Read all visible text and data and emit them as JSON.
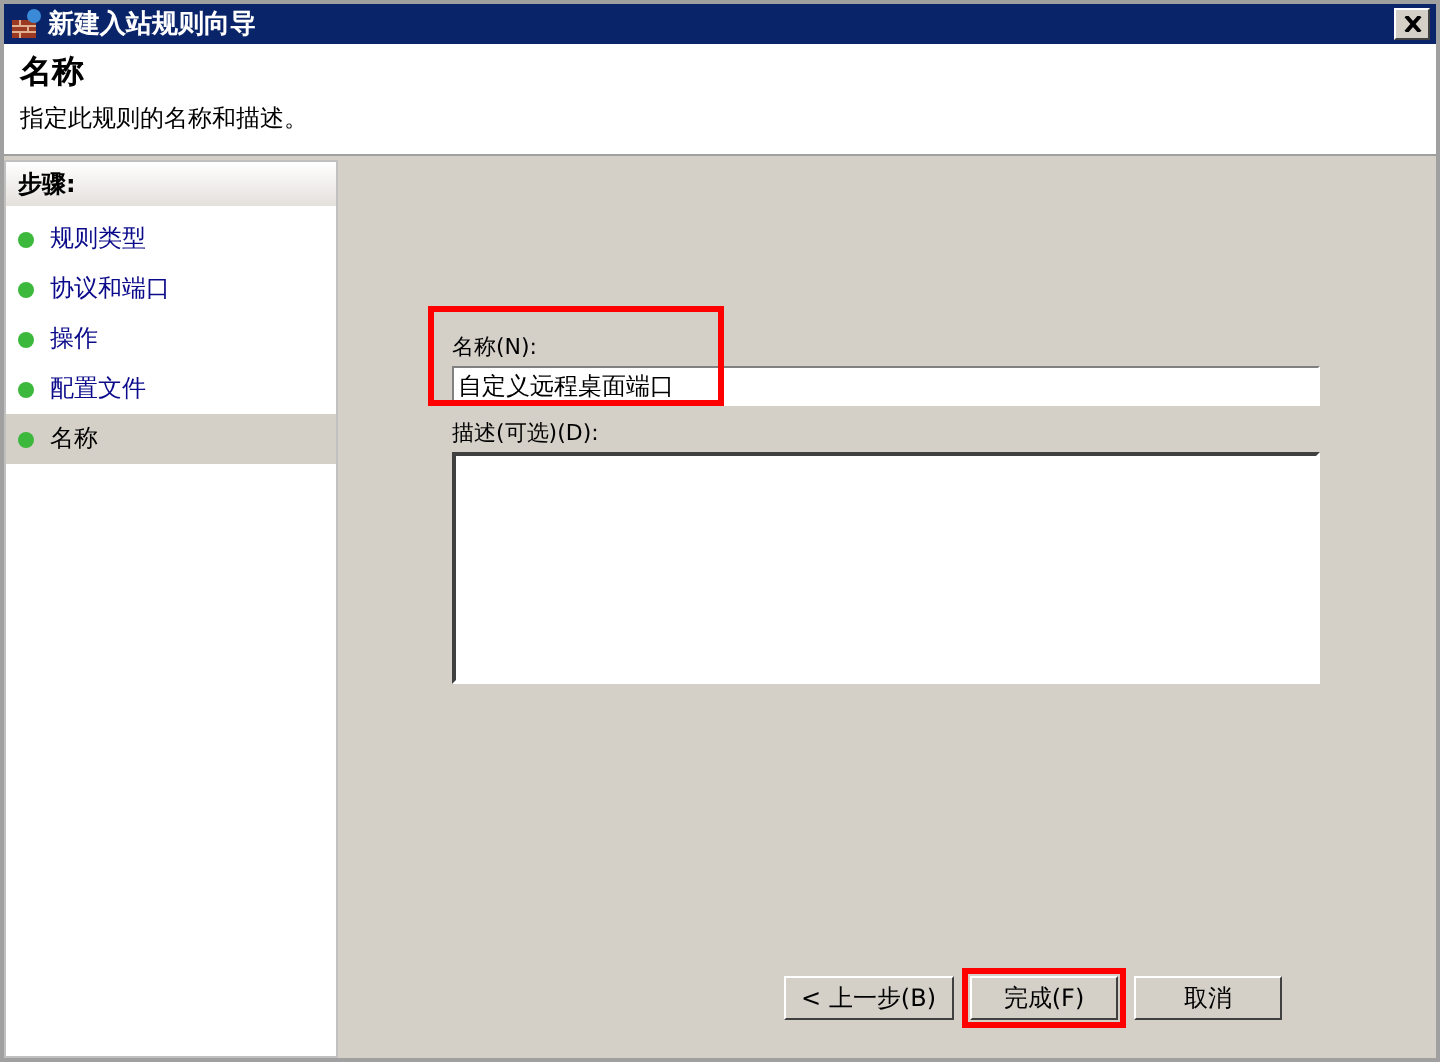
{
  "window": {
    "title": "新建入站规则向导"
  },
  "header": {
    "title": "名称",
    "subtitle": "指定此规则的名称和描述。"
  },
  "steps": {
    "heading": "步骤:",
    "items": [
      {
        "label": "规则类型",
        "selected": false
      },
      {
        "label": "协议和端口",
        "selected": false
      },
      {
        "label": "操作",
        "selected": false
      },
      {
        "label": "配置文件",
        "selected": false
      },
      {
        "label": "名称",
        "selected": true
      }
    ]
  },
  "form": {
    "name_label": "名称(N):",
    "name_value": "自定义远程桌面端口",
    "name_highlighted": true,
    "description_label": "描述(可选)(D):"
  },
  "buttons": [
    {
      "label": "< 上一步(B)",
      "highlighted": false
    },
    {
      "label": "完成(F)",
      "highlighted": true
    },
    {
      "label": "取消",
      "highlighted": false
    }
  ]
}
